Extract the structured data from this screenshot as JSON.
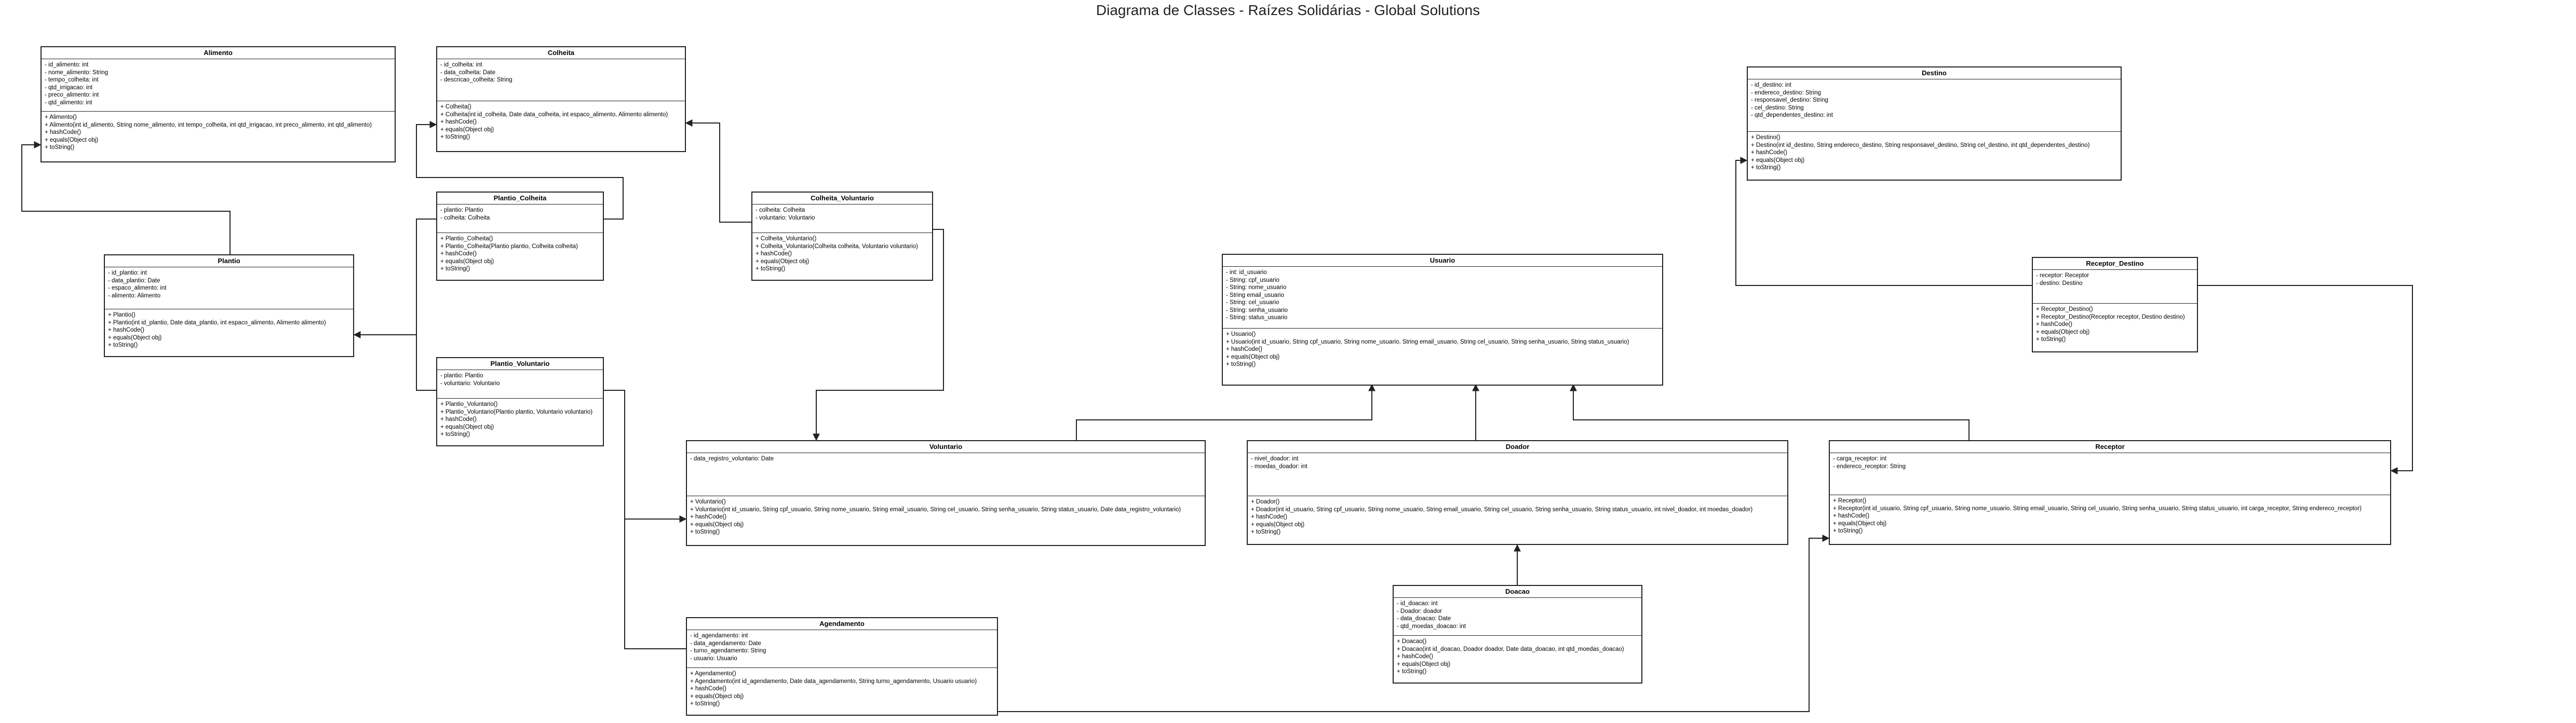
{
  "title": "Diagrama de Classes - Raízes Solidárias - Global Solutions",
  "classes": {
    "alimento": {
      "name": "Alimento",
      "attributes": [
        "- id_alimento: int",
        "- nome_alimento: String",
        "- tempo_colheita: int",
        "- qtd_irrigacao: int",
        "- preco_alimento: int",
        "- qtd_alimento: int"
      ],
      "methods": [
        "+ Alimento()",
        "+ Alimento(int id_alimento, String nome_alimento, int tempo_colheita, int qtd_irrigacao, int preco_alimento, int qtd_alimento)",
        "+ hashCode()",
        "+ equals(Object obj)",
        "+ toString()"
      ]
    },
    "colheita": {
      "name": "Colheita",
      "attributes": [
        "- id_colheita: int",
        "- data_colheita: Date",
        "- descricao_colheita: String"
      ],
      "methods": [
        "+ Colheita()",
        "+ Colheita(int id_colheita, Date data_colheita, int espaco_alimento, Alimento alimento)",
        "+ hashCode()",
        "+ equals(Object obj)",
        "+ toString()"
      ]
    },
    "plantio": {
      "name": "Plantio",
      "attributes": [
        "- id_plantio: int",
        "- data_plantio: Date",
        "- espaco_alimento: int",
        "- alimento: Alimento"
      ],
      "methods": [
        "+ Plantio()",
        "+ Plantio(int id_plantio, Date data_plantio, int espaco_alimento, Alimento alimento)",
        "+ hashCode()",
        "+ equals(Object obj)",
        "+ toString()"
      ]
    },
    "plantio_colheita": {
      "name": "Plantio_Colheita",
      "attributes": [
        "- plantio: Plantio",
        "- colheita: Colheita"
      ],
      "methods": [
        "+ Plantio_Colheita()",
        "+ Plantio_Colheita(Plantio plantio, Colheita colheita)",
        "+ hashCode()",
        "+ equals(Object obj)",
        "+ toString()"
      ]
    },
    "colheita_voluntario": {
      "name": "Colheita_Voluntario",
      "attributes": [
        "- colheita: Colheita",
        "- voluntario: Voluntario"
      ],
      "methods": [
        "+ Colheita_Voluntario()",
        "+ Colheita_Voluntario(Colheita colheita, Voluntario voluntario)",
        "+ hashCode()",
        "+ equals(Object obj)",
        "+ toString()"
      ]
    },
    "plantio_voluntario": {
      "name": "Plantio_Voluntario",
      "attributes": [
        "- plantio: Plantio",
        "- voluntario: Voluntario"
      ],
      "methods": [
        "+ Plantio_Voluntario()",
        "+ Plantio_Voluntario(Plantio plantio, Voluntario voluntario)",
        "+ hashCode()",
        "+ equals(Object obj)",
        "+ toString()"
      ]
    },
    "destino": {
      "name": "Destino",
      "attributes": [
        "- id_destino: int",
        "- endereco_destino: String",
        "- responsavel_destino: String",
        "- cel_destino: String",
        "- qtd_dependentes_destino: int"
      ],
      "methods": [
        "+ Destino()",
        "+ Destino(int id_destino, String endereco_destino, String responsavel_destino, String cel_destino, int qtd_dependentes_destino)",
        "+ hashCode()",
        "+ equals(Object obj)",
        "+ toString()"
      ]
    },
    "usuario": {
      "name": "Usuario",
      "attributes": [
        "- int: id_usuario",
        "- String: cpf_usuario",
        "- String: nome_usuario",
        "- String email_usuario",
        "- String: cel_usuario",
        "- String: senha_usuario",
        "- String: status_usuario"
      ],
      "methods": [
        "+ Usuario()",
        "+ Usuario(int id_usuario, String cpf_usuario, String nome_usuario, String email_usuario, String cel_usuario, String senha_usuario, String status_usuario)",
        "+ hashCode()",
        "+ equals(Object obj)",
        "+ toString()"
      ]
    },
    "receptor_destino": {
      "name": "Receptor_Destino",
      "attributes": [
        "- receptor: Receptor",
        "- destino: Destino"
      ],
      "methods": [
        "+ Receptor_Destino()",
        "+ Receptor_Destino(Receptor receptor, Destino destino)",
        "+ hashCode()",
        "+ equals(Object obj)",
        "+ toString()"
      ]
    },
    "voluntario": {
      "name": "Voluntario",
      "attributes": [
        "- data_registro_voluntario: Date"
      ],
      "methods": [
        "+ Voluntario()",
        "+ Voluntario(int id_usuario, String cpf_usuario, String nome_usuario, String email_usuario, String cel_usuario, String senha_usuario, String status_usuario, Date data_registro_voluntario)",
        "+ hashCode()",
        "+ equals(Object obj)",
        "+ toString()"
      ]
    },
    "doador": {
      "name": "Doador",
      "attributes": [
        "- nivel_doador: int",
        "- moedas_doador: int"
      ],
      "methods": [
        "+ Doador()",
        "+ Doador(int id_usuario, String cpf_usuario, String nome_usuario, String email_usuario, String cel_usuario, String senha_usuario, String status_usuario, int nivel_doador, int moedas_doador)",
        "+ hashCode()",
        "+ equals(Object obj)",
        "+ toString()"
      ]
    },
    "receptor": {
      "name": "Receptor",
      "attributes": [
        "- carga_receptor: int",
        "- endereco_receptor: String"
      ],
      "methods": [
        "+ Receptor()",
        "+ Receptor(int id_usuario, String cpf_usuario, String nome_usuario, String email_usuario, String cel_usuario, String senha_usuario, String status_usuario, int carga_receptor, String endereco_receptor)",
        "+ hashCode()",
        "+ equals(Object obj)",
        "+ toString()"
      ]
    },
    "doacao": {
      "name": "Doacao",
      "attributes": [
        "- id_doacao: int",
        "- Doador: doador",
        "- data_doacao: Date",
        "- qtd_moedas_doacao: int"
      ],
      "methods": [
        "+ Doacao()",
        "+ Doacao(int id_doacao, Doador doador, Date data_doacao, int qtd_moedas_doacao)",
        "+ hashCode()",
        "+ equals(Object obj)",
        "+ toString()"
      ]
    },
    "agendamento": {
      "name": "Agendamento",
      "attributes": [
        "- id_agendamento: int",
        "- data_agendamento: Date",
        "- turno_agendamento: String",
        "- usuario: Usuario"
      ],
      "methods": [
        "+ Agendamento()",
        "+ Agendamento(int id_agendamento, Date data_agendamento, String turno_agendamento, Usuario usuario)",
        "+ hashCode()",
        "+ equals(Object obj)",
        "+ toString()"
      ]
    }
  }
}
